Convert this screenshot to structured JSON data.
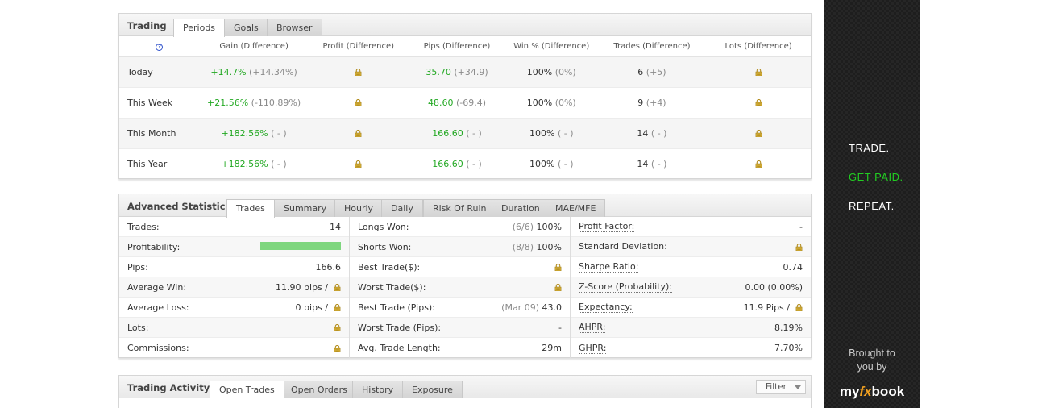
{
  "trading": {
    "title": "Trading",
    "tabs": [
      "Periods",
      "Goals",
      "Browser"
    ],
    "headers": [
      "Gain (Difference)",
      "Profit (Difference)",
      "Pips (Difference)",
      "Win % (Difference)",
      "Trades (Difference)",
      "Lots (Difference)"
    ],
    "rows": [
      {
        "label": "Today",
        "gain": "+14.7%",
        "gain_diff": "(+14.34%)",
        "pips": "35.70",
        "pips_diff": "(+34.9)",
        "win": "100%",
        "win_diff": "(0%)",
        "trades": "6",
        "trades_diff": "(+5)"
      },
      {
        "label": "This Week",
        "gain": "+21.56%",
        "gain_diff": "(-110.89%)",
        "pips": "48.60",
        "pips_diff": "(-69.4)",
        "win": "100%",
        "win_diff": "(0%)",
        "trades": "9",
        "trades_diff": "(+4)"
      },
      {
        "label": "This Month",
        "gain": "+182.56%",
        "gain_diff": "( - )",
        "pips": "166.60",
        "pips_diff": "( - )",
        "win": "100%",
        "win_diff": "( - )",
        "trades": "14",
        "trades_diff": "( - )"
      },
      {
        "label": "This Year",
        "gain": "+182.56%",
        "gain_diff": "( - )",
        "pips": "166.60",
        "pips_diff": "( - )",
        "win": "100%",
        "win_diff": "( - )",
        "trades": "14",
        "trades_diff": "( - )"
      }
    ]
  },
  "advanced": {
    "title": "Advanced Statistics",
    "tabs": [
      "Trades",
      "Summary",
      "Hourly",
      "Daily",
      "Risk Of Ruin",
      "Duration",
      "MAE/MFE"
    ],
    "profitability_fraction": 1.0,
    "col1": [
      {
        "k": "Trades:",
        "v": "14"
      },
      {
        "k": "Profitability:",
        "v": ""
      },
      {
        "k": "Pips:",
        "v": "166.6"
      },
      {
        "k": "Average Win:",
        "v": "11.90 pips /"
      },
      {
        "k": "Average Loss:",
        "v": "0 pips /"
      },
      {
        "k": "Lots:",
        "v": ""
      },
      {
        "k": "Commissions:",
        "v": ""
      }
    ],
    "col2": [
      {
        "k": "Longs Won:",
        "pre": "(6/6)",
        "v": "100%"
      },
      {
        "k": "Shorts Won:",
        "pre": "(8/8)",
        "v": "100%"
      },
      {
        "k": "Best Trade($):",
        "pre": "",
        "v": ""
      },
      {
        "k": "Worst Trade($):",
        "pre": "",
        "v": ""
      },
      {
        "k": "Best Trade (Pips):",
        "pre": "(Mar 09)",
        "v": "43.0"
      },
      {
        "k": "Worst Trade (Pips):",
        "pre": "",
        "v": "-"
      },
      {
        "k": "Avg. Trade Length:",
        "pre": "",
        "v": "29m"
      }
    ],
    "col3": [
      {
        "k": "Profit Factor:",
        "v": "-"
      },
      {
        "k": "Standard Deviation:",
        "v": ""
      },
      {
        "k": "Sharpe Ratio:",
        "v": "0.74"
      },
      {
        "k": "Z-Score (Probability):",
        "v": "0.00 (0.00%)"
      },
      {
        "k": "Expectancy:",
        "v": "11.9 Pips /"
      },
      {
        "k": "AHPR:",
        "v": "8.19%"
      },
      {
        "k": "GHPR:",
        "v": "7.70%"
      }
    ]
  },
  "activity": {
    "title": "Trading Activity",
    "tabs": [
      "Open Trades",
      "Open Orders",
      "History",
      "Exposure"
    ],
    "filter_label": "Filter"
  },
  "banner": {
    "line1": "TRADE.",
    "line2": "GET PAID.",
    "line3": "REPEAT.",
    "brought1": "Brought to",
    "brought2": "you by",
    "logo_my": "my",
    "logo_fx": "fx",
    "logo_book": "book",
    "accent": "#22cc22"
  },
  "colors": {
    "gain": "#22a822",
    "lock": "#c9a227"
  }
}
